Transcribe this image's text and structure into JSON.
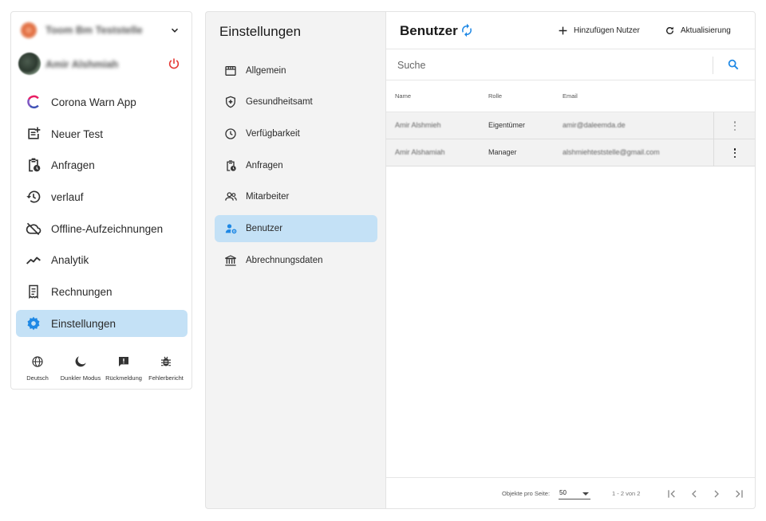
{
  "sidebar": {
    "location_name": "Toom Bm Teststelle",
    "user_name": "Amir Alshmiah",
    "items": [
      {
        "label": "Corona Warn App"
      },
      {
        "label": "Neuer Test"
      },
      {
        "label": "Anfragen"
      },
      {
        "label": "verlauf"
      },
      {
        "label": "Offline-Aufzeichnungen"
      },
      {
        "label": "Analytik"
      },
      {
        "label": "Rechnungen"
      },
      {
        "label": "Einstellungen"
      }
    ],
    "footer": [
      {
        "label": "Deutsch"
      },
      {
        "label": "Dunkler Modus"
      },
      {
        "label": "Rückmeldung"
      },
      {
        "label": "Fehlerbericht"
      }
    ]
  },
  "settings": {
    "title": "Einstellungen",
    "items": [
      {
        "label": "Allgemein"
      },
      {
        "label": "Gesundheitsamt"
      },
      {
        "label": "Verfügbarkeit"
      },
      {
        "label": "Anfragen"
      },
      {
        "label": "Mitarbeiter"
      },
      {
        "label": "Benutzer"
      },
      {
        "label": "Abrechnungsdaten"
      }
    ]
  },
  "main": {
    "title": "Benutzer",
    "add_label": "Hinzufügen Nutzer",
    "refresh_label": "Aktualisierung",
    "search_placeholder": "Suche",
    "columns": [
      "Name",
      "Rolle",
      "Email"
    ],
    "rows": [
      {
        "name": "Amir Alshmieh",
        "role": "Eigentümer",
        "email": "amir@daleemda.de"
      },
      {
        "name": "Amir Alshamiah",
        "role": "Manager",
        "email": "alshmiehteststelle@gmail.com"
      }
    ],
    "pagination": {
      "per_page_label": "Objekte pro Seite:",
      "per_page_value": "50",
      "range": "1 - 2 von 2"
    }
  },
  "colors": {
    "accent": "#1e88e5",
    "active_bg": "#c4e1f6",
    "power_red": "#e53935"
  }
}
